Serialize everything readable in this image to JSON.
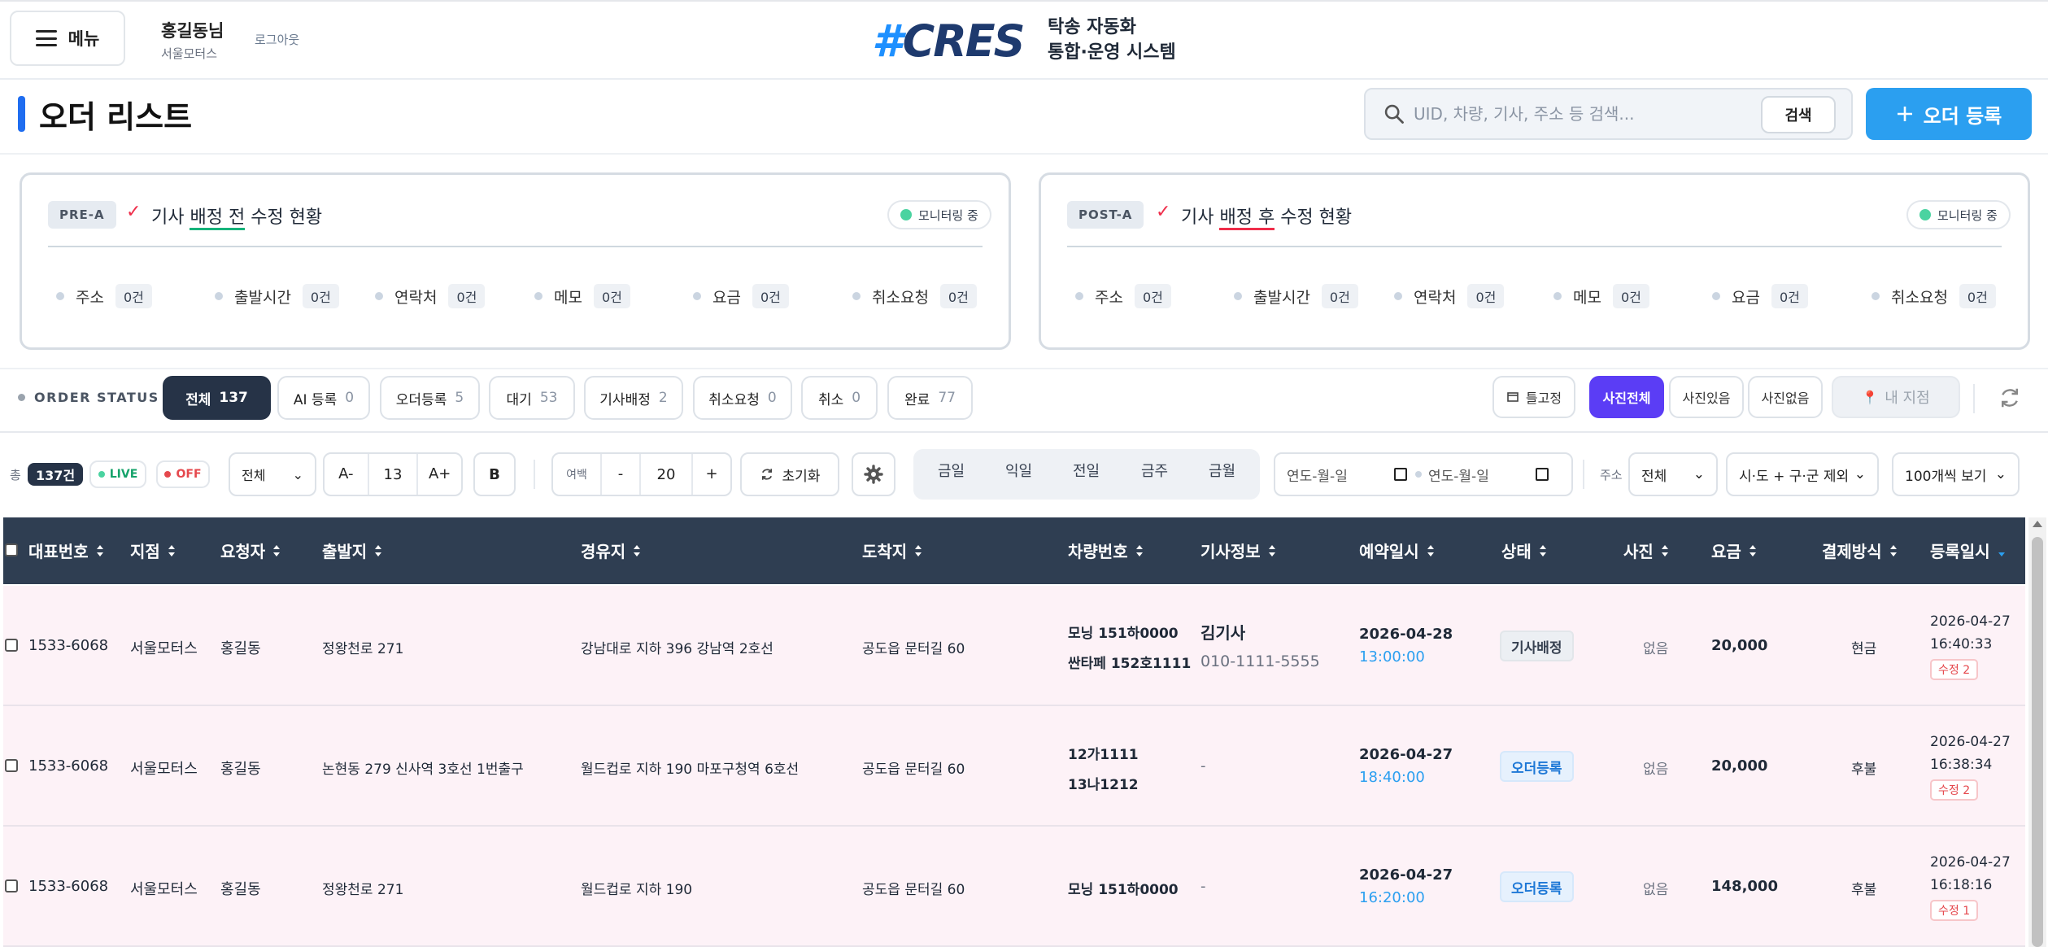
{
  "header": {
    "menu_label": "메뉴",
    "user_name": "홍길동님",
    "user_company": "서울모터스",
    "logout_label": "로그아웃",
    "logo_hash": "#",
    "logo_text": "CRES",
    "system_title_line1": "탁송 자동화",
    "system_title_line2": "통합·운영 시스템"
  },
  "page": {
    "title": "오더 리스트",
    "search_placeholder": "UID, 차량, 기사, 주소 등 검색...",
    "search_button": "검색",
    "register_button": "오더 등록",
    "accent_color": "#2b9ff0"
  },
  "panels": [
    {
      "badge": "PRE-A",
      "title_pre": "기사 ",
      "title_mark": "배정 전",
      "title_post": " 수정 현황",
      "monitor_label": "모니터링 중",
      "stats": [
        {
          "label": "주소",
          "count": "0건"
        },
        {
          "label": "출발시간",
          "count": "0건"
        },
        {
          "label": "연락처",
          "count": "0건"
        },
        {
          "label": "메모",
          "count": "0건"
        },
        {
          "label": "요금",
          "count": "0건"
        },
        {
          "label": "취소요청",
          "count": "0건"
        }
      ]
    },
    {
      "badge": "POST-A",
      "title_pre": "기사 ",
      "title_mark": "배정 후",
      "title_post": " 수정 현황",
      "monitor_label": "모니터링 중",
      "stats": [
        {
          "label": "주소",
          "count": "0건"
        },
        {
          "label": "출발시간",
          "count": "0건"
        },
        {
          "label": "연락처",
          "count": "0건"
        },
        {
          "label": "메모",
          "count": "0건"
        },
        {
          "label": "요금",
          "count": "0건"
        },
        {
          "label": "취소요청",
          "count": "0건"
        }
      ]
    }
  ],
  "order_status": {
    "label": "ORDER STATUS",
    "tabs": [
      {
        "label": "전체",
        "count": "137"
      },
      {
        "label": "AI 등록",
        "count": "0"
      },
      {
        "label": "오더등록",
        "count": "5"
      },
      {
        "label": "대기",
        "count": "53"
      },
      {
        "label": "기사배정",
        "count": "2"
      },
      {
        "label": "취소요청",
        "count": "0"
      },
      {
        "label": "취소",
        "count": "0"
      },
      {
        "label": "완료",
        "count": "77"
      }
    ],
    "pin_label": "틀고정",
    "photo_all": "사진전체",
    "photo_yes": "사진있음",
    "photo_no": "사진없음",
    "my_branch": "내 지점"
  },
  "toolbar": {
    "total_label": "총",
    "total_count": "137건",
    "live_label": "LIVE",
    "off_label": "OFF",
    "filter_select": "전체",
    "font_minus": "A-",
    "font_size": "13",
    "font_plus": "A+",
    "bold_label": "B",
    "margin_label": "여백",
    "margin_minus": "-",
    "margin_value": "20",
    "margin_plus": "+",
    "reset_label": "초기화",
    "date_presets": [
      "금일",
      "익일",
      "전일",
      "금주",
      "금월"
    ],
    "date_placeholder_start": "연도-월-일",
    "date_placeholder_end": "연도-월-일",
    "address_label": "주소",
    "address_select": "전체",
    "region_select": "시·도 + 구·군 제외",
    "page_size_select": "100개씩 보기"
  },
  "table": {
    "headers": [
      "대표번호",
      "지점",
      "요청자",
      "출발지",
      "경유지",
      "도착지",
      "차량번호",
      "기사정보",
      "예약일시",
      "상태",
      "사진",
      "요금",
      "결제방식",
      "등록일시"
    ],
    "rows": [
      {
        "phone": "1533-6068",
        "branch": "서울모터스",
        "requester": "홍길동",
        "origin": "정왕천로 271",
        "waypoint": "강남대로 지하 396 강남역 2호선",
        "destination": "공도읍 문터길 60",
        "vehicle1": "모닝 151하0000",
        "vehicle2": "싼타페 152호1111",
        "driver_name": "김기사",
        "driver_phone": "010-1111-5555",
        "res_date": "2026-04-28",
        "res_time": "13:00:00",
        "status": "기사배정",
        "photo": "없음",
        "fee": "20,000",
        "payment": "현금",
        "reg_date": "2026-04-27",
        "reg_time": "16:40:33",
        "edit": "수정 2"
      },
      {
        "phone": "1533-6068",
        "branch": "서울모터스",
        "requester": "홍길동",
        "origin": "논현동 279 신사역 3호선 1번출구",
        "waypoint": "월드컵로 지하 190 마포구청역 6호선",
        "destination": "공도읍 문터길 60",
        "vehicle1": "12가1111",
        "vehicle2": "13나1212",
        "driver_name": "-",
        "driver_phone": "",
        "res_date": "2026-04-27",
        "res_time": "18:40:00",
        "status": "오더등록",
        "photo": "없음",
        "fee": "20,000",
        "payment": "후불",
        "reg_date": "2026-04-27",
        "reg_time": "16:38:34",
        "edit": "수정 2"
      },
      {
        "phone": "1533-6068",
        "branch": "서울모터스",
        "requester": "홍길동",
        "origin": "정왕천로 271",
        "waypoint": "월드컵로 지하 190",
        "destination": "공도읍 문터길 60",
        "vehicle1": "모닝 151하0000",
        "vehicle2": "",
        "driver_name": "-",
        "driver_phone": "",
        "res_date": "2026-04-27",
        "res_time": "16:20:00",
        "status": "오더등록",
        "photo": "없음",
        "fee": "148,000",
        "payment": "후불",
        "reg_date": "2026-04-27",
        "reg_time": "16:18:16",
        "edit": "수정 1"
      }
    ]
  }
}
